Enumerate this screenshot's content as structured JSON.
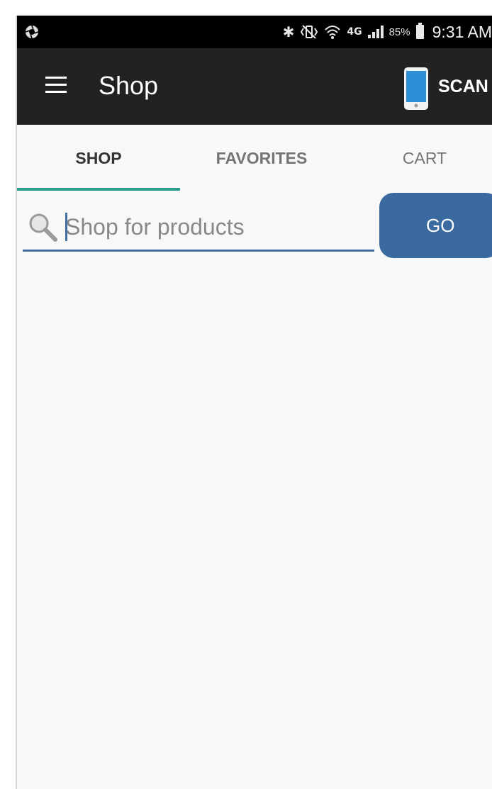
{
  "status_bar": {
    "battery_percent": "85%",
    "time": "9:31 AM",
    "network": "4G",
    "icons": [
      "aperture-icon",
      "bluetooth-icon",
      "vibrate-icon",
      "wifi-icon",
      "network-4g-icon",
      "signal-icon",
      "battery-icon"
    ]
  },
  "app_bar": {
    "title": "Shop",
    "scan_label": "SCAN",
    "menu_icon": "hamburger-menu-icon",
    "phone_icon": "smartphone-icon"
  },
  "tabs": [
    {
      "label": "SHOP",
      "active": true
    },
    {
      "label": "FAVORITES",
      "active": false
    },
    {
      "label": "CART",
      "active": false
    }
  ],
  "search": {
    "placeholder": "Shop for products",
    "value": "",
    "icon": "magnifier-icon"
  },
  "go_button": {
    "label": "GO"
  },
  "colors": {
    "app_bar": "#222222",
    "status_bar": "#000000",
    "tab_indicator": "#2a9d8f",
    "accent": "#3a6a9f",
    "background": "#f8f8f8"
  }
}
